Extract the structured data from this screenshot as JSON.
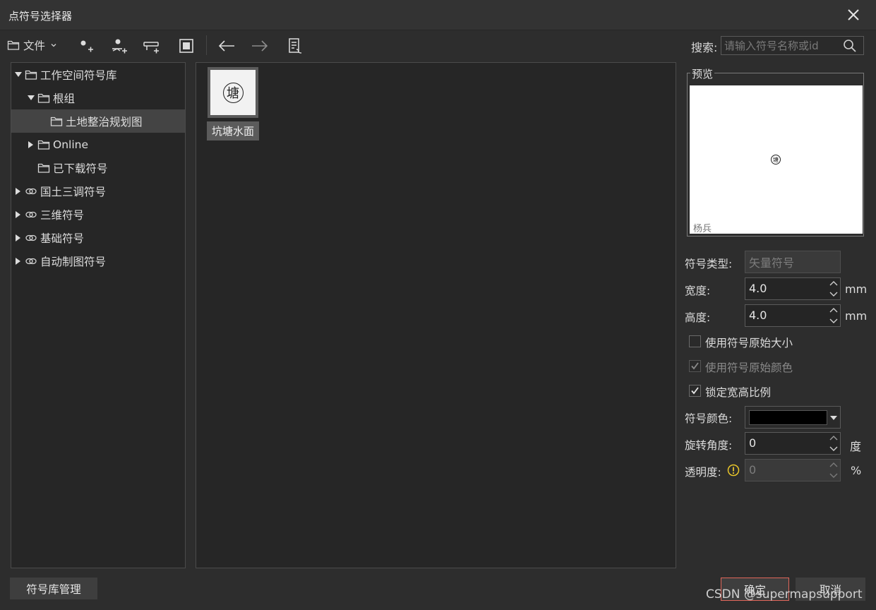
{
  "window": {
    "title": "点符号选择器"
  },
  "toolbar": {
    "file_label": "文件",
    "search_label": "搜索:",
    "search_placeholder": "请输入符号名称或id"
  },
  "tree": {
    "items": [
      {
        "label": "工作空间符号库",
        "expanded": true,
        "icon": "folder-icon"
      },
      {
        "label": "根组",
        "expanded": true,
        "icon": "folder-icon"
      },
      {
        "label": "土地整治规划图",
        "selected": true,
        "icon": "folder-icon"
      },
      {
        "label": "Online",
        "expanded": false,
        "icon": "folder-icon"
      },
      {
        "label": "已下载符号",
        "icon": "folder-icon"
      },
      {
        "label": "国土三调符号",
        "expanded": false,
        "icon": "link-icon"
      },
      {
        "label": "三维符号",
        "expanded": false,
        "icon": "link-icon"
      },
      {
        "label": "基础符号",
        "expanded": false,
        "icon": "link-icon"
      },
      {
        "label": "自动制图符号",
        "expanded": false,
        "icon": "link-icon"
      }
    ]
  },
  "symbols": [
    {
      "name": "坑塘水面",
      "glyph": "塘"
    }
  ],
  "preview": {
    "title": "预览",
    "glyph": "塘",
    "caption": "杨兵"
  },
  "properties": {
    "type_label": "符号类型:",
    "type_value": "矢量符号",
    "width_label": "宽度:",
    "width_value": "4.0",
    "width_unit": "mm",
    "height_label": "高度:",
    "height_value": "4.0",
    "height_unit": "mm",
    "cb_original_size": {
      "label": "使用符号原始大小",
      "checked": false,
      "enabled": true
    },
    "cb_original_color": {
      "label": "使用符号原始颜色",
      "checked": true,
      "enabled": false
    },
    "cb_lock_ratio": {
      "label": "锁定宽高比例",
      "checked": true,
      "enabled": true
    },
    "color_label": "符号颜色:",
    "color_value": "#000000",
    "rotation_label": "旋转角度:",
    "rotation_value": "0",
    "rotation_unit": "度",
    "opacity_label": "透明度:",
    "opacity_value": "0",
    "opacity_unit": "%"
  },
  "footer": {
    "manage_label": "符号库管理",
    "ok_label": "确定",
    "cancel_label": "取消",
    "watermark": "CSDN @supermapsupport"
  },
  "colors": {
    "background": "#2d2d2d",
    "panel": "#262626",
    "selected_row": "#444444",
    "ok_border": "#e0665a",
    "warning": "#e8c52a"
  }
}
